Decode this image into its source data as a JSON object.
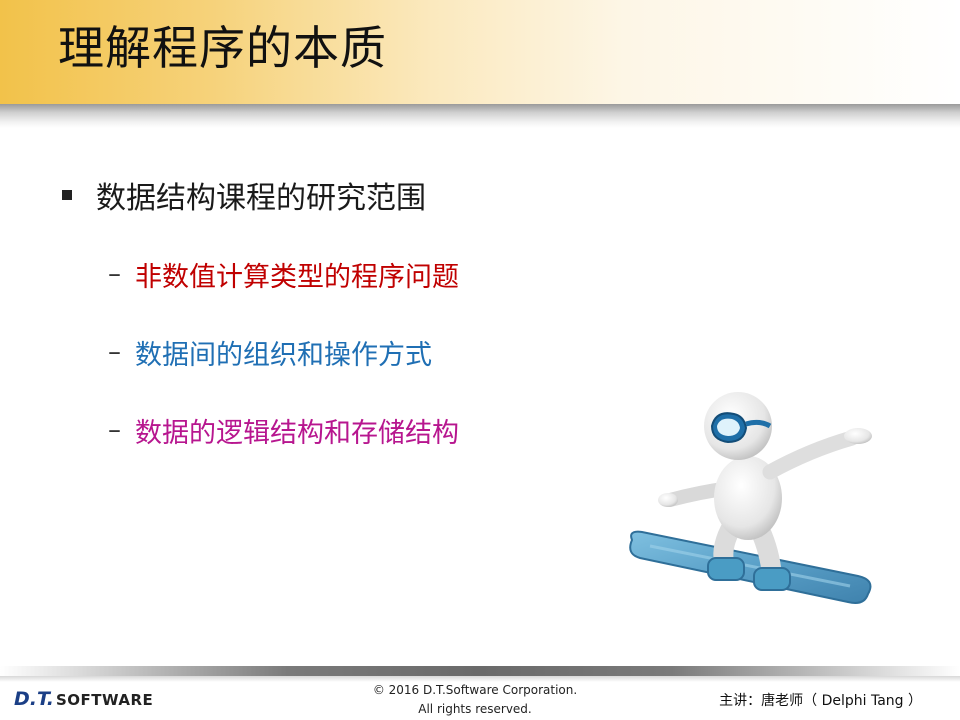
{
  "slide": {
    "title": "理解程序的本质",
    "bullet": "数据结构课程的研究范围",
    "sub_items": [
      {
        "text": "非数值计算类型的程序问题",
        "color": "#c00000"
      },
      {
        "text": "数据间的组织和操作方式",
        "color": "#1f6fb4"
      },
      {
        "text": "数据的逻辑结构和存储结构",
        "color": "#b7168f"
      }
    ],
    "dash": "–"
  },
  "footer": {
    "logo_main": "D.T.",
    "logo_sub": "SOFTWARE",
    "copyright_line1": "© 2016 D.T.Software Corporation.",
    "copyright_line2": "All rights reserved.",
    "presenter": "主讲：唐老师（ Delphi Tang ）"
  },
  "colors": {
    "title_band": "#f2c24a",
    "logo_blue": "#1b3f86",
    "board_blue": "#5aa0c8"
  },
  "icons": {
    "illustration": "snowboarder-figure",
    "bullet": "square-bullet-icon"
  }
}
